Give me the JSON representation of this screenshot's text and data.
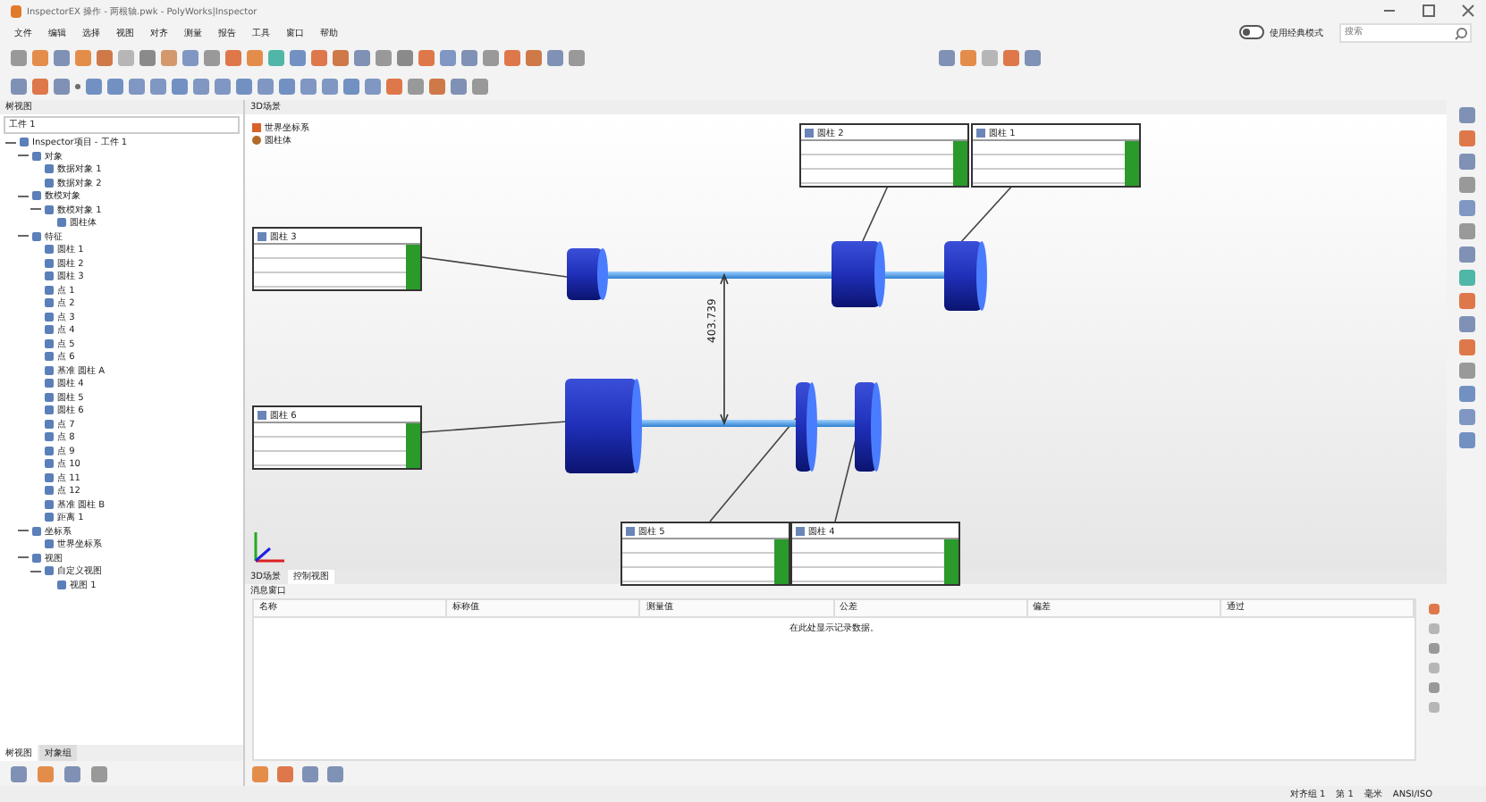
{
  "window": {
    "title": "InspectorEX 操作 - 两根轴.pwk - PolyWorks|Inspector"
  },
  "menu": [
    "文件",
    "编辑",
    "选择",
    "视图",
    "对齐",
    "测量",
    "报告",
    "工具",
    "窗口",
    "帮助"
  ],
  "search": {
    "toggle_label": "使用经典模式",
    "toggle_on": false,
    "placeholder": "搜索"
  },
  "tree_panel": {
    "title": "树视图",
    "selector": "工件 1",
    "items": [
      {
        "label": "Inspector项目 - 工件 1",
        "expanded": true,
        "children": [
          {
            "label": "对象",
            "expanded": true,
            "children": [
              {
                "label": "数据对象 1"
              },
              {
                "label": "数据对象 2"
              }
            ]
          },
          {
            "label": "数模对象",
            "expanded": true,
            "children": [
              {
                "label": "数模对象 1",
                "expanded": true,
                "children": [
                  {
                    "label": "圆柱体"
                  }
                ]
              }
            ]
          },
          {
            "label": "特征",
            "expanded": true,
            "children": [
              {
                "label": "圆柱 1"
              },
              {
                "label": "圆柱 2"
              },
              {
                "label": "圆柱 3"
              },
              {
                "label": "点 1"
              },
              {
                "label": "点 2"
              },
              {
                "label": "点 3"
              },
              {
                "label": "点 4"
              },
              {
                "label": "点 5"
              },
              {
                "label": "点 6"
              },
              {
                "label": "基准 圆柱 A"
              },
              {
                "label": "圆柱 4"
              },
              {
                "label": "圆柱 5"
              },
              {
                "label": "圆柱 6"
              },
              {
                "label": "点 7"
              },
              {
                "label": "点 8"
              },
              {
                "label": "点 9"
              },
              {
                "label": "点 10"
              },
              {
                "label": "点 11"
              },
              {
                "label": "点 12"
              },
              {
                "label": "基准 圆柱 B"
              },
              {
                "label": "距离 1"
              }
            ]
          },
          {
            "label": "坐标系",
            "expanded": true,
            "children": [
              {
                "label": "世界坐标系"
              }
            ]
          },
          {
            "label": "视图",
            "expanded": true,
            "children": [
              {
                "label": "自定义视图",
                "expanded": true,
                "children": [
                  {
                    "label": "视图 1"
                  }
                ]
              }
            ]
          }
        ]
      }
    ],
    "tabs": [
      {
        "label": "树视图",
        "selected": true
      },
      {
        "label": "对象组",
        "selected": false
      }
    ]
  },
  "viewport": {
    "title": "3D场景",
    "legend": [
      "世界坐标系",
      "圆柱体"
    ],
    "dimension": "403.739",
    "callouts": [
      {
        "name": "圆柱 2",
        "pass": true
      },
      {
        "name": "圆柱 1",
        "pass": true
      },
      {
        "name": "圆柱 3",
        "pass": true
      },
      {
        "name": "圆柱 6",
        "pass": true
      },
      {
        "name": "圆柱 5",
        "pass": true
      },
      {
        "name": "圆柱 4",
        "pass": true
      }
    ]
  },
  "bottom_tabs": [
    {
      "label": "3D场景",
      "selected": false
    },
    {
      "label": "控制视图",
      "selected": true
    }
  ],
  "messages": {
    "title": "消息窗口",
    "columns": [
      "名称",
      "标称值",
      "测量值",
      "公差",
      "偏差",
      "通过"
    ],
    "empty": "在此处显示记录数据。"
  },
  "status_bar": [
    "对齐组 1",
    "第 1",
    "毫米",
    "ANSI/ISO"
  ]
}
